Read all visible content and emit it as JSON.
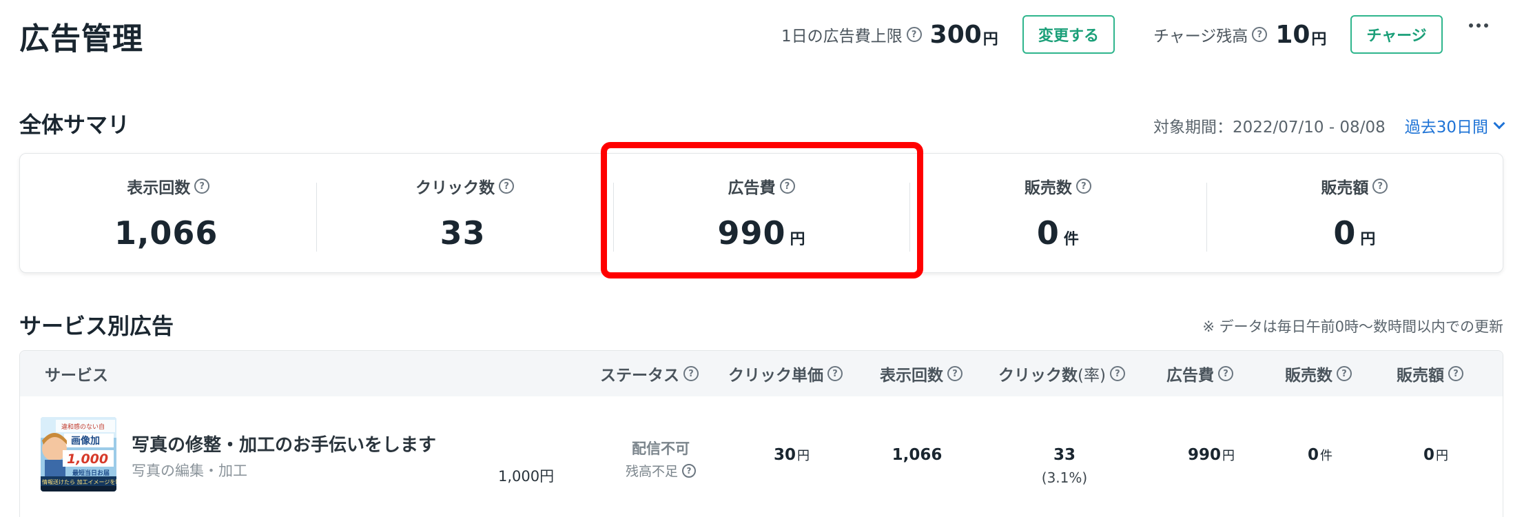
{
  "header": {
    "title": "広告管理",
    "daily_limit_label": "1日の広告費上限",
    "daily_limit_value": "300",
    "daily_limit_unit": "円",
    "change_button": "変更する",
    "balance_label": "チャージ残高",
    "balance_value": "10",
    "balance_unit": "円",
    "charge_button": "チャージ",
    "more_icon": "more-horizontal-icon"
  },
  "summary": {
    "title": "全体サマリ",
    "period_text": "対象期間：2022/07/10 - 08/08",
    "period_select": "過去30日間",
    "metrics": [
      {
        "label": "表示回数",
        "value": "1,066",
        "unit": ""
      },
      {
        "label": "クリック数",
        "value": "33",
        "unit": ""
      },
      {
        "label": "広告費",
        "value": "990",
        "unit": "円"
      },
      {
        "label": "販売数",
        "value": "0",
        "unit": "件"
      },
      {
        "label": "販売額",
        "value": "0",
        "unit": "円"
      }
    ],
    "highlight_color": "#ff0000"
  },
  "services": {
    "title": "サービス別広告",
    "note": "※ データは毎日午前0時～数時間以内での更新",
    "columns": {
      "service": "サービス",
      "status": "ステータス",
      "cpc": "クリック単価",
      "impressions": "表示回数",
      "clicks": "クリック数",
      "clicks_rate_suffix": "(率)",
      "cost": "広告費",
      "sales_count": "販売数",
      "sales_amount": "販売額"
    },
    "rows": [
      {
        "thumbnail_texts": [
          "違和感のない自",
          "画像加",
          "1,000",
          "最短当日お届",
          "情報送けたら 加工イメージを制"
        ],
        "title": "写真の修整・加工のお手伝いをします",
        "category": "写真の編集・加工",
        "price": "1,000円",
        "status_main": "配信不可",
        "status_sub": "残高不足",
        "cpc": "30",
        "cpc_unit": "円",
        "impressions": "1,066",
        "clicks": "33",
        "click_rate": "(3.1%)",
        "cost": "990",
        "cost_unit": "円",
        "sales_count": "0",
        "sales_count_unit": "件",
        "sales_amount": "0",
        "sales_amount_unit": "円"
      }
    ]
  },
  "colors": {
    "accent_green": "#2eb58c",
    "link_blue": "#1e73d6"
  }
}
